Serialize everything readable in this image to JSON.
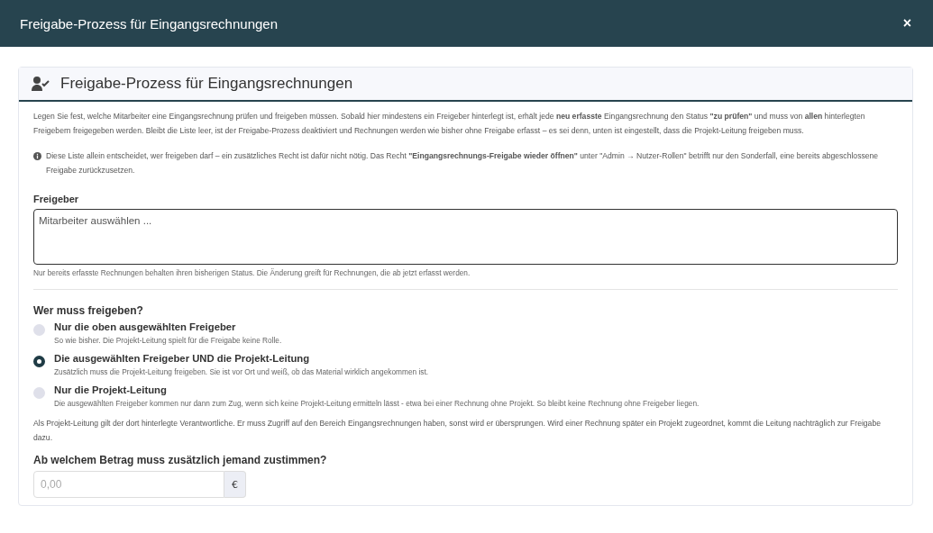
{
  "window": {
    "title": "Freigabe-Prozess für Eingangsrechnungen",
    "close": "×"
  },
  "card": {
    "title": "Freigabe-Prozess für Eingangsrechnungen",
    "intro": "Legen Sie fest, welche Mitarbeiter eine Eingangsrechnung prüfen und freigeben müssen. Sobald hier mindestens ein Freigeber hinterlegt ist, erhält jede **neu erfasste** Eingangsrechnung den Status **\"zu prüfen\"** und muss von **allen** hinterlegten Freigebern freigegeben werden. Bleibt die Liste leer, ist der Freigabe-Prozess deaktiviert und Rechnungen werden wie bisher ohne Freigabe erfasst – es sei denn, unten ist eingestellt, dass die Projekt-Leitung freigeben muss.",
    "info": "Diese Liste allein entscheidet, wer freigeben darf – ein zusätzliches Recht ist dafür nicht nötig. Das Recht **\"Eingangsrechnungs-Freigabe wieder öffnen\"** unter \"Admin → Nutzer-Rollen\" betrifft nur den Sonderfall, eine bereits abgeschlossene Freigabe zurückzusetzen.",
    "approvers": {
      "label": "Freigeber",
      "placeholder": "Mitarbeiter auswählen ...",
      "help": "Nur bereits erfasste Rechnungen behalten ihren bisherigen Status. Die Änderung greift für Rechnungen, die ab jetzt erfasst werden."
    },
    "who": {
      "label": "Wer muss freigeben?",
      "options": [
        {
          "label": "Nur die oben ausgewählten Freigeber",
          "help": "So wie bisher. Die Projekt-Leitung spielt für die Freigabe keine Rolle.",
          "selected": false
        },
        {
          "label": "Die ausgewählten Freigeber UND die Projekt-Leitung",
          "help": "Zusätzlich muss die Projekt-Leitung freigeben. Sie ist vor Ort und weiß, ob das Material wirklich angekommen ist.",
          "selected": true
        },
        {
          "label": "Nur die Projekt-Leitung",
          "help": "Die ausgewählten Freigeber kommen nur dann zum Zug, wenn sich keine Projekt-Leitung ermitteln lässt - etwa bei einer Rechnung ohne Projekt. So bleibt keine Rechnung ohne Freigeber liegen.",
          "selected": false
        }
      ],
      "note": "Als Projekt-Leitung gilt der dort hinterlegte Verantwortliche. Er muss Zugriff auf den Bereich Eingangsrechnungen haben, sonst wird er übersprungen. Wird einer Rechnung später ein Projekt zugeordnet, kommt die Leitung nachträglich zur Freigabe dazu."
    },
    "amount": {
      "label": "Ab welchem Betrag muss zusätzlich jemand zustimmen?",
      "placeholder": "0,00",
      "unit": "€"
    }
  }
}
